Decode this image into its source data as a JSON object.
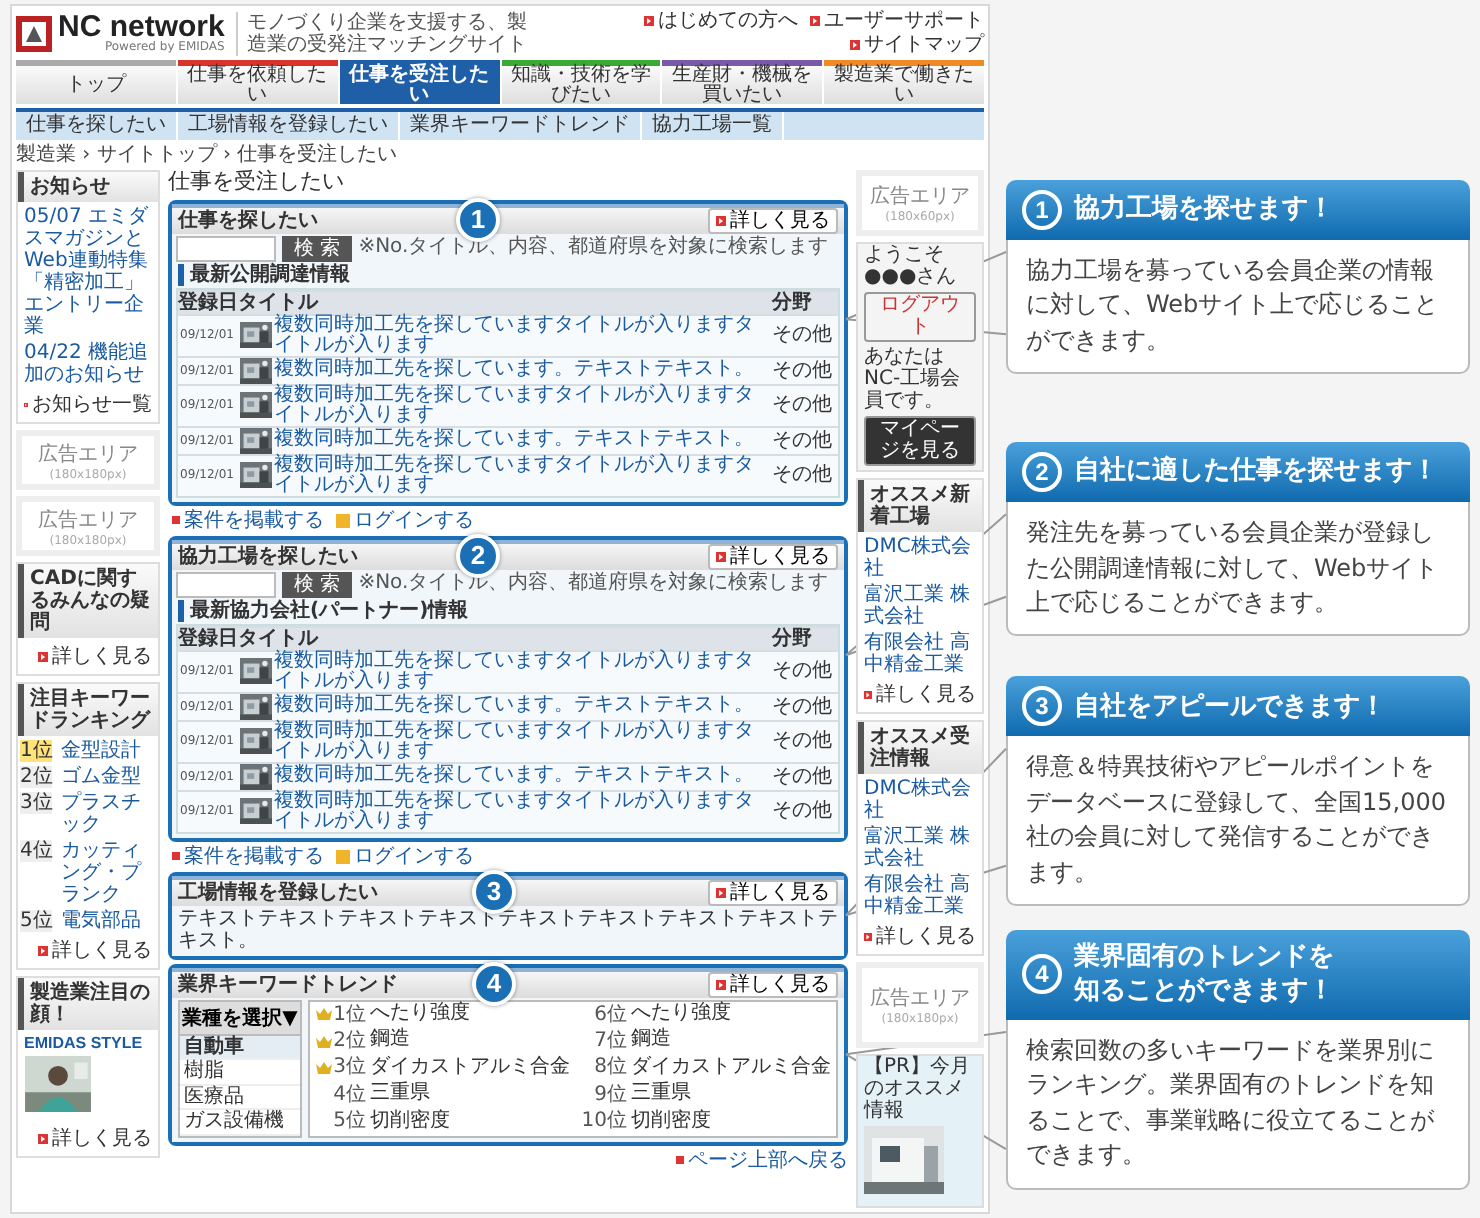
{
  "site": {
    "logo": "NC network",
    "logo_sub": "Powered by EMIDAS",
    "tagline": "モノづくり企業を支援する、製造業の受発注マッチングサイト",
    "top_links": [
      "はじめての方へ",
      "ユーザーサポート",
      "サイトマップ"
    ],
    "tabs": [
      {
        "label": "トップ",
        "selected": false,
        "color": "#aaaaaa"
      },
      {
        "label": "仕事を依頼したい",
        "selected": false,
        "color": "#d9342b"
      },
      {
        "label": "仕事を受注したい",
        "selected": true,
        "color": "#1f5fa8"
      },
      {
        "label": "知識・技術を学びたい",
        "selected": false,
        "color": "#3aaa35"
      },
      {
        "label": "生産財・機械を買いたい",
        "selected": false,
        "color": "#7a5aa8"
      },
      {
        "label": "製造業で働きたい",
        "selected": false,
        "color": "#f08a24"
      }
    ],
    "subnav": [
      "仕事を探したい",
      "工場情報を登録したい",
      "業界キーワードトレンド",
      "協力工場一覧"
    ],
    "breadcrumb": "製造業 › サイトトップ › 仕事を受注したい"
  },
  "left": {
    "news": {
      "title": "お知らせ",
      "items": [
        "05/07 エミダスマガジンとWeb連動特集「精密加工」エントリー企業",
        "04/22 機能追加のお知らせ"
      ],
      "more": "お知らせ一覧"
    },
    "ads": [
      {
        "title": "広告エリア",
        "size": "(180x180px)"
      },
      {
        "title": "広告エリア",
        "size": "(180x180px)"
      }
    ],
    "faq": {
      "title": "CADに関するみんなの疑問",
      "more": "詳しく見る"
    },
    "ranking": {
      "title": "注目キーワードランキング",
      "items": [
        {
          "rank": "1位",
          "word": "金型設計"
        },
        {
          "rank": "2位",
          "word": "ゴム金型"
        },
        {
          "rank": "3位",
          "word": "プラスチック"
        },
        {
          "rank": "4位",
          "word": "カッティング・プランク"
        },
        {
          "rank": "5位",
          "word": "電気部品"
        }
      ],
      "more": "詳しく見る"
    },
    "face": {
      "title": "製造業注目の顔！",
      "brand": "EMIDAS STYLE",
      "more": "詳しく見る"
    }
  },
  "main": {
    "title": "仕事を受注したい",
    "sections": [
      {
        "kind": "table",
        "badge": "1",
        "title": "仕事を探したい",
        "more": "詳しく見る",
        "search_button": "検 索",
        "search_hint": "※No.タイトル、内容、都道府県を対象に検索します",
        "subtitle": "最新公開調達情報",
        "columns": [
          "登録日",
          "タイトル",
          "分野"
        ],
        "rows": [
          {
            "date": "09/12/01",
            "title": "複数同時加工先を探していますタイトルが入りますタイトルが入ります",
            "field": "その他"
          },
          {
            "date": "09/12/01",
            "title": "複数同時加工先を探しています。テキストテキスト。",
            "field": "その他"
          },
          {
            "date": "09/12/01",
            "title": "複数同時加工先を探していますタイトルが入りますタイトルが入ります",
            "field": "その他"
          },
          {
            "date": "09/12/01",
            "title": "複数同時加工先を探しています。テキストテキスト。",
            "field": "その他"
          },
          {
            "date": "09/12/01",
            "title": "複数同時加工先を探していますタイトルが入りますタイトルが入ります",
            "field": "その他"
          }
        ],
        "links": [
          "案件を掲載する",
          "ログインする"
        ]
      },
      {
        "kind": "table",
        "badge": "2",
        "title": "協力工場を探したい",
        "more": "詳しく見る",
        "search_button": "検 索",
        "search_hint": "※No.タイトル、内容、都道府県を対象に検索します",
        "subtitle": "最新協力会社(パートナー)情報",
        "columns": [
          "登録日",
          "タイトル",
          "分野"
        ],
        "rows": [
          {
            "date": "09/12/01",
            "title": "複数同時加工先を探していますタイトルが入りますタイトルが入ります",
            "field": "その他"
          },
          {
            "date": "09/12/01",
            "title": "複数同時加工先を探しています。テキストテキスト。",
            "field": "その他"
          },
          {
            "date": "09/12/01",
            "title": "複数同時加工先を探していますタイトルが入りますタイトルが入ります",
            "field": "その他"
          },
          {
            "date": "09/12/01",
            "title": "複数同時加工先を探しています。テキストテキスト。",
            "field": "その他"
          },
          {
            "date": "09/12/01",
            "title": "複数同時加工先を探していますタイトルが入りますタイトルが入ります",
            "field": "その他"
          }
        ],
        "links": [
          "案件を掲載する",
          "ログインする"
        ]
      },
      {
        "kind": "text",
        "badge": "3",
        "title": "工場情報を登録したい",
        "more": "詳しく見る",
        "text": "テキストテキストテキストテキストテキストテキストテキストテキストテキスト。"
      },
      {
        "kind": "trend",
        "badge": "4",
        "title": "業界キーワードトレンド",
        "more": "詳しく見る",
        "picker": "業種を選択▼",
        "industries": [
          {
            "label": "自動車",
            "selected": true
          },
          {
            "label": "樹脂",
            "selected": false
          },
          {
            "label": "医療品",
            "selected": false
          },
          {
            "label": "ガス設備機",
            "selected": false
          }
        ],
        "ranks": [
          {
            "rank": "1位",
            "word": "へたり強度",
            "crown": true
          },
          {
            "rank": "6位",
            "word": "へたり強度",
            "crown": false
          },
          {
            "rank": "2位",
            "word": "鋼造",
            "crown": true
          },
          {
            "rank": "7位",
            "word": "鋼造",
            "crown": false
          },
          {
            "rank": "3位",
            "word": "ダイカストアルミ合金",
            "crown": true
          },
          {
            "rank": "8位",
            "word": "ダイカストアルミ合金",
            "crown": false
          },
          {
            "rank": "4位",
            "word": "三重県",
            "crown": false
          },
          {
            "rank": "9位",
            "word": "三重県",
            "crown": false
          },
          {
            "rank": "5位",
            "word": "切削密度",
            "crown": false
          },
          {
            "rank": "10位",
            "word": "切削密度",
            "crown": false
          }
        ]
      }
    ],
    "footer_link": "ページ上部へ戻る"
  },
  "right": {
    "ads": [
      {
        "title": "広告エリア",
        "size": "(180x60px)"
      },
      {
        "title": "広告エリア",
        "size": "(180x180px)"
      }
    ],
    "welcome": {
      "greeting": "ようこそ●●●さん",
      "logout": "ログアウト",
      "status": "あなたはNC-工場会員です。",
      "mypage": "マイページを見る"
    },
    "lists": [
      {
        "title": "オススメ新着工場",
        "items": [
          "DMC株式会社",
          "富沢工業 株式会社",
          "有限会社 高中精金工業"
        ],
        "more": "詳しく見る"
      },
      {
        "title": "オススメ受注情報",
        "items": [
          "DMC株式会社",
          "富沢工業 株式会社",
          "有限会社 高中精金工業"
        ],
        "more": "詳しく見る"
      }
    ],
    "pr": {
      "title": "【PR】今月のオススメ情報"
    }
  },
  "callouts": [
    {
      "number": "1",
      "title_lines": [
        "協力工場を探せます！"
      ],
      "body": "協力工場を募っている会員企業の情報に対して、Webサイト上で応じることができます。"
    },
    {
      "number": "2",
      "title_lines": [
        "自社に適した仕事を探せます！"
      ],
      "body": "発注先を募っている会員企業が登録した公開調達情報に対して、Webサイト上で応じることができます。"
    },
    {
      "number": "3",
      "title_lines": [
        "自社をアピールできます！"
      ],
      "body": "得意＆特異技術やアピールポイントをデータベースに登録して、全国15,000社の会員に対して発信することができます。"
    },
    {
      "number": "4",
      "title_lines": [
        "業界固有のトレンドを",
        "知ることができます！"
      ],
      "body": "検索回数の多いキーワードを業界別にランキング。業界固有のトレンドを知ることで、事業戦略に役立てることができます。"
    }
  ]
}
